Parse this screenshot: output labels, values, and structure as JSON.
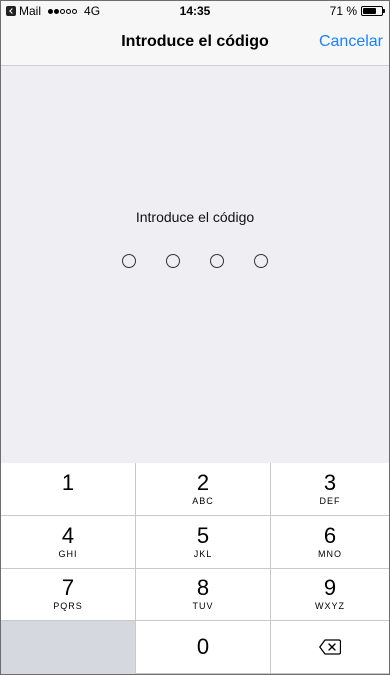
{
  "status_bar": {
    "back_app": "Mail",
    "network": "4G",
    "time": "14:35",
    "battery": "71 %",
    "battery_level": 0.71,
    "signal_bars": 2
  },
  "nav": {
    "title": "Introduce el código",
    "cancel_label": "Cancelar"
  },
  "passcode": {
    "prompt": "Introduce el código",
    "digits_count": 4
  },
  "keypad": {
    "keys": [
      {
        "digit": "1",
        "letters": ""
      },
      {
        "digit": "2",
        "letters": "ABC"
      },
      {
        "digit": "3",
        "letters": "DEF"
      },
      {
        "digit": "4",
        "letters": "GHI"
      },
      {
        "digit": "5",
        "letters": "JKL"
      },
      {
        "digit": "6",
        "letters": "MNO"
      },
      {
        "digit": "7",
        "letters": "PQRS"
      },
      {
        "digit": "8",
        "letters": "TUV"
      },
      {
        "digit": "9",
        "letters": "WXYZ"
      },
      {
        "digit": "0",
        "letters": ""
      }
    ],
    "delete_icon": "backspace-icon"
  },
  "colors": {
    "accent": "#1a82fb",
    "background": "#eeeef3",
    "keypad_border": "#c8c8cd"
  }
}
